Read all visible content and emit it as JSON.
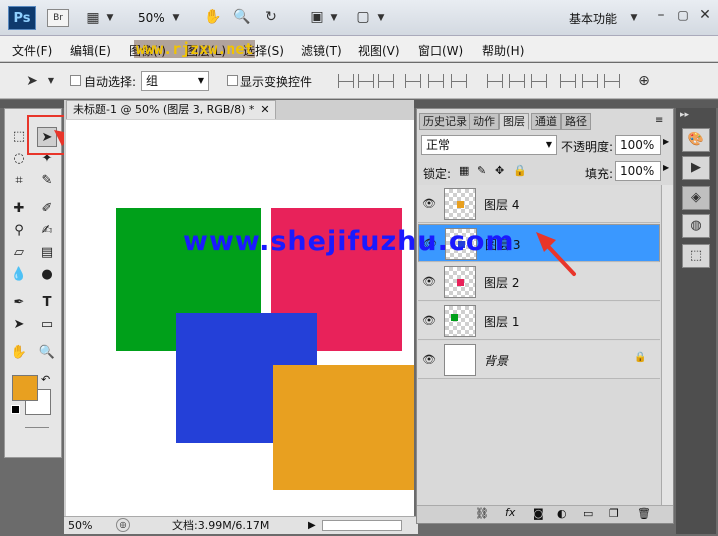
{
  "app": {
    "logo": "Ps",
    "bridge": "Br",
    "zoom": "50%",
    "workspace": "基本功能"
  },
  "menu": [
    "文件(F)",
    "编辑(E)",
    "图像(I)",
    "图层(L)",
    "选择(S)",
    "滤镜(T)",
    "视图(V)",
    "窗口(W)",
    "帮助(H)"
  ],
  "options": {
    "auto_select_label": "自动选择:",
    "auto_select_value": "组",
    "show_transform_label": "显示变换控件"
  },
  "document": {
    "tab_title": "未标题-1 @ 50% (图层 3, RGB/8) *",
    "status_zoom": "50%",
    "status_info": "文档:3.99M/6.17M"
  },
  "colors": {
    "foreground": "#e8a020",
    "background": "#ffffff",
    "green": "#00a01a",
    "red": "#e8225a",
    "blue": "#2440d8",
    "orange": "#e8a020",
    "selected_layer": "#3a98ff",
    "annotation": "#e8352a"
  },
  "panel": {
    "tabs": [
      "历史记录",
      "动作",
      "图层",
      "通道",
      "路径"
    ],
    "active_tab": "图层",
    "blend_mode": "正常",
    "opacity_label": "不透明度:",
    "opacity_value": "100%",
    "lock_label": "锁定:",
    "fill_label": "填充:",
    "fill_value": "100%",
    "layers": [
      {
        "name": "图层 4",
        "thumb_color": "#e8a020",
        "selected": false
      },
      {
        "name": "图层 3",
        "thumb_color": "#2440d8",
        "selected": true
      },
      {
        "name": "图层 2",
        "thumb_color": "#e8225a",
        "selected": false
      },
      {
        "name": "图层 1",
        "thumb_color": "#00a01a",
        "selected": false
      },
      {
        "name": "背景",
        "thumb_color": "#ffffff",
        "selected": false
      }
    ]
  },
  "watermarks": {
    "main": "www.shejifuzhu.com",
    "top": "www.rjzxw.net"
  }
}
